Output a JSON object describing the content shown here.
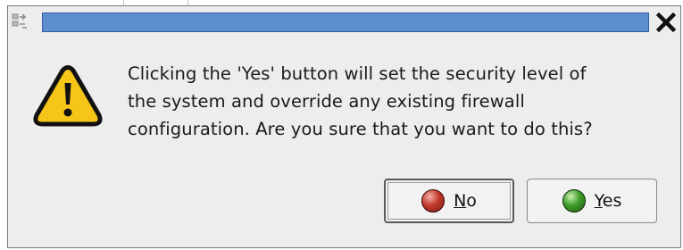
{
  "window": {
    "title": "",
    "close_icon": "close-icon",
    "menu_icon": "window-menu-icon"
  },
  "dialog": {
    "icon": "warning-icon",
    "message_lines": [
      "Clicking the 'Yes' button will set the security level of",
      "the system and override any existing firewall",
      "configuration.  Are you sure that you want to do this?"
    ]
  },
  "buttons": {
    "no": {
      "mnemonic": "N",
      "rest": "o",
      "icon": "red-ball-icon"
    },
    "yes": {
      "mnemonic": "Y",
      "rest": "es",
      "icon": "green-ball-icon"
    }
  },
  "colors": {
    "titlebar": "#5d8fd0",
    "dialog_bg": "#ededed",
    "warning_fill": "#f5c518",
    "no_icon": "#c0392b",
    "yes_icon": "#3f9b2a"
  }
}
